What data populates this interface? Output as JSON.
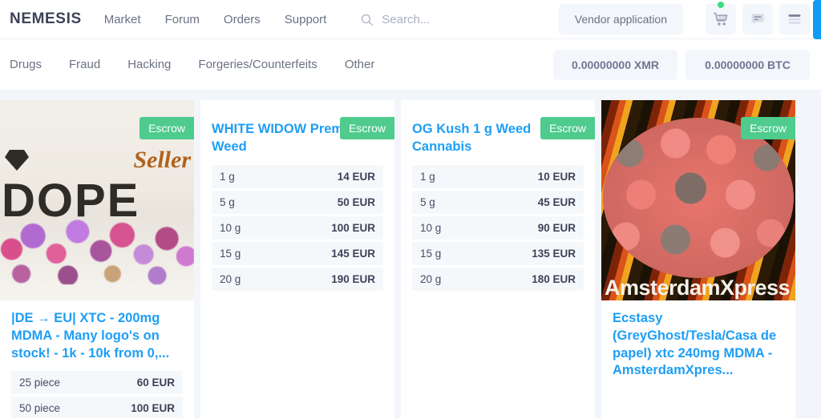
{
  "header": {
    "logo": "NEMESIS",
    "nav": [
      {
        "label": "Market"
      },
      {
        "label": "Forum"
      },
      {
        "label": "Orders"
      },
      {
        "label": "Support"
      }
    ],
    "search": {
      "placeholder": "Search...",
      "value": "",
      "icon": "search-icon"
    },
    "vendor_application": "Vendor application",
    "icons": [
      {
        "name": "cart-icon",
        "badge": true
      },
      {
        "name": "messages-icon",
        "badge": false
      },
      {
        "name": "menu-icon",
        "badge": false
      }
    ]
  },
  "categories": [
    {
      "label": "Drugs"
    },
    {
      "label": "Fraud"
    },
    {
      "label": "Hacking"
    },
    {
      "label": "Forgeries/Counterfeits"
    },
    {
      "label": "Other"
    }
  ],
  "balances": [
    {
      "label": "0.00000000 XMR"
    },
    {
      "label": "0.00000000 BTC"
    }
  ],
  "colors": {
    "accent_blue": "#1e9ef5",
    "escrow_green": "#4ecb8d",
    "page_bg": "#f2f6fa",
    "chip_bg": "#f3f6fa",
    "text": "#6b7186"
  },
  "products": [
    {
      "badge": "Escrow",
      "has_image": true,
      "image_alt": "dope-seller-pills-photo",
      "title": "|DE → EU| XTC - 200mg MDMA - Many logo's on stock! - 1k - 10k from 0,...",
      "prices": [
        {
          "qty": "25 piece",
          "amount": "60 EUR"
        },
        {
          "qty": "50 piece",
          "amount": "100 EUR"
        }
      ]
    },
    {
      "badge": "Escrow",
      "has_image": false,
      "title": "WHITE WIDOW Premium Weed",
      "prices": [
        {
          "qty": "1 g",
          "amount": "14 EUR"
        },
        {
          "qty": "5 g",
          "amount": "50 EUR"
        },
        {
          "qty": "10 g",
          "amount": "100 EUR"
        },
        {
          "qty": "15 g",
          "amount": "145 EUR"
        },
        {
          "qty": "20 g",
          "amount": "190 EUR"
        }
      ]
    },
    {
      "badge": "Escrow",
      "has_image": false,
      "title": "OG Kush 1 g Weed Cannabis",
      "prices": [
        {
          "qty": "1 g",
          "amount": "10 EUR"
        },
        {
          "qty": "5 g",
          "amount": "45 EUR"
        },
        {
          "qty": "10 g",
          "amount": "90 EUR"
        },
        {
          "qty": "15 g",
          "amount": "135 EUR"
        },
        {
          "qty": "20 g",
          "amount": "180 EUR"
        }
      ]
    },
    {
      "badge": "Escrow",
      "has_image": true,
      "image_alt": "ecstasy-pills-bowl-photo",
      "image_caption": "AmsterdamXpress",
      "title": "Ecstasy (GreyGhost/Tesla/Casa de papel) xtc 240mg MDMA -AmsterdamXpres...",
      "prices": []
    }
  ],
  "artwork": {
    "card1_word": "DOPE",
    "card1_seller": "Seller",
    "card4_caption": "AmsterdamXpress"
  }
}
